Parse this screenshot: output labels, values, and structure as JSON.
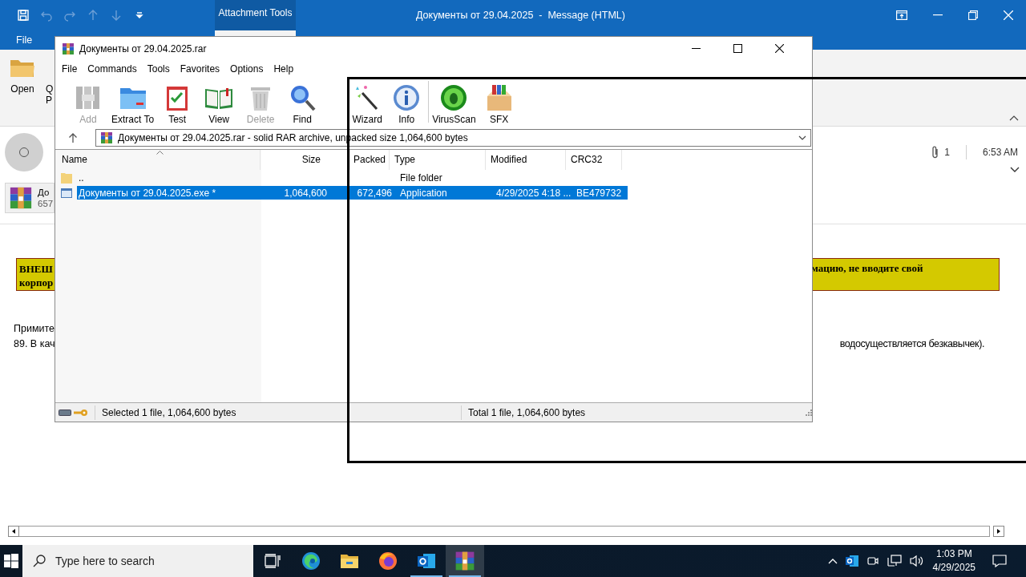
{
  "outlook": {
    "quick_access": [
      {
        "kind": "save",
        "disabled": false
      },
      {
        "kind": "undo",
        "disabled": true
      },
      {
        "kind": "redo",
        "disabled": true
      },
      {
        "kind": "up",
        "disabled": true
      },
      {
        "kind": "down",
        "disabled": true
      },
      {
        "kind": "customize",
        "disabled": false
      }
    ],
    "contextual_tab": "Attachment Tools",
    "title": "Документы от 29.04.2025  -  Message (HTML)",
    "file_tab": "File",
    "ribbon": {
      "open": "Open",
      "partial_top": "Q",
      "partial_bottom": "P"
    },
    "header": {
      "attachment_count": "1",
      "time": "6:53 AM",
      "attachment_name": "До",
      "attachment_size": "657"
    },
    "banner": {
      "left_line_1": "ВНЕШ",
      "left_line_2": "корпор",
      "right_line_1": "мацию, не вводите свой"
    },
    "body": {
      "line_1_left": "Примите",
      "line_2_left": "89. В кач",
      "line_2_right": "водосуществляется безкавычек)."
    }
  },
  "winrar": {
    "title": "Документы от 29.04.2025.rar",
    "menu": [
      "File",
      "Commands",
      "Tools",
      "Favorites",
      "Options",
      "Help"
    ],
    "toolbar": [
      {
        "kind": "add",
        "label": "Add",
        "disabled": true
      },
      {
        "kind": "extract",
        "label": "Extract To",
        "disabled": false
      },
      {
        "kind": "test",
        "label": "Test",
        "disabled": false
      },
      {
        "kind": "view",
        "label": "View",
        "disabled": false
      },
      {
        "kind": "delete",
        "label": "Delete",
        "disabled": true
      },
      {
        "kind": "find",
        "label": "Find",
        "disabled": false
      },
      {
        "kind": "wizard",
        "label": "Wizard",
        "disabled": false
      },
      {
        "kind": "info",
        "label": "Info",
        "disabled": false
      },
      {
        "kind": "virus",
        "label": "VirusScan",
        "disabled": false
      },
      {
        "kind": "sfx",
        "label": "SFX",
        "disabled": false
      }
    ],
    "address": "Документы от 29.04.2025.rar - solid RAR archive, unpacked size 1,064,600 bytes",
    "columns": [
      "Name",
      "Size",
      "Packed",
      "Type",
      "Modified",
      "CRC32"
    ],
    "rows": [
      {
        "kind": "folder",
        "name": "..",
        "type": "File folder",
        "selected": false
      },
      {
        "kind": "file",
        "name": "Документы от 29.04.2025.exe *",
        "size": "1,064,600",
        "packed": "672,496",
        "type": "Application",
        "modified": "4/29/2025 4:18 ...",
        "crc": "BE479732",
        "selected": true
      }
    ],
    "status_left": "Selected 1 file, 1,064,600 bytes",
    "status_right": "Total 1 file, 1,064,600 bytes"
  },
  "taskbar": {
    "search_placeholder": "Type here to search",
    "apps": [
      {
        "kind": "taskview",
        "running": false,
        "selected": false
      },
      {
        "kind": "edge",
        "running": false,
        "selected": false
      },
      {
        "kind": "explorer",
        "running": false,
        "selected": false
      },
      {
        "kind": "firefox",
        "running": false,
        "selected": false
      },
      {
        "kind": "outlook",
        "running": true,
        "selected": false
      },
      {
        "kind": "winrar",
        "running": true,
        "selected": true
      }
    ],
    "time": "1:03 PM",
    "date": "4/29/2025"
  }
}
